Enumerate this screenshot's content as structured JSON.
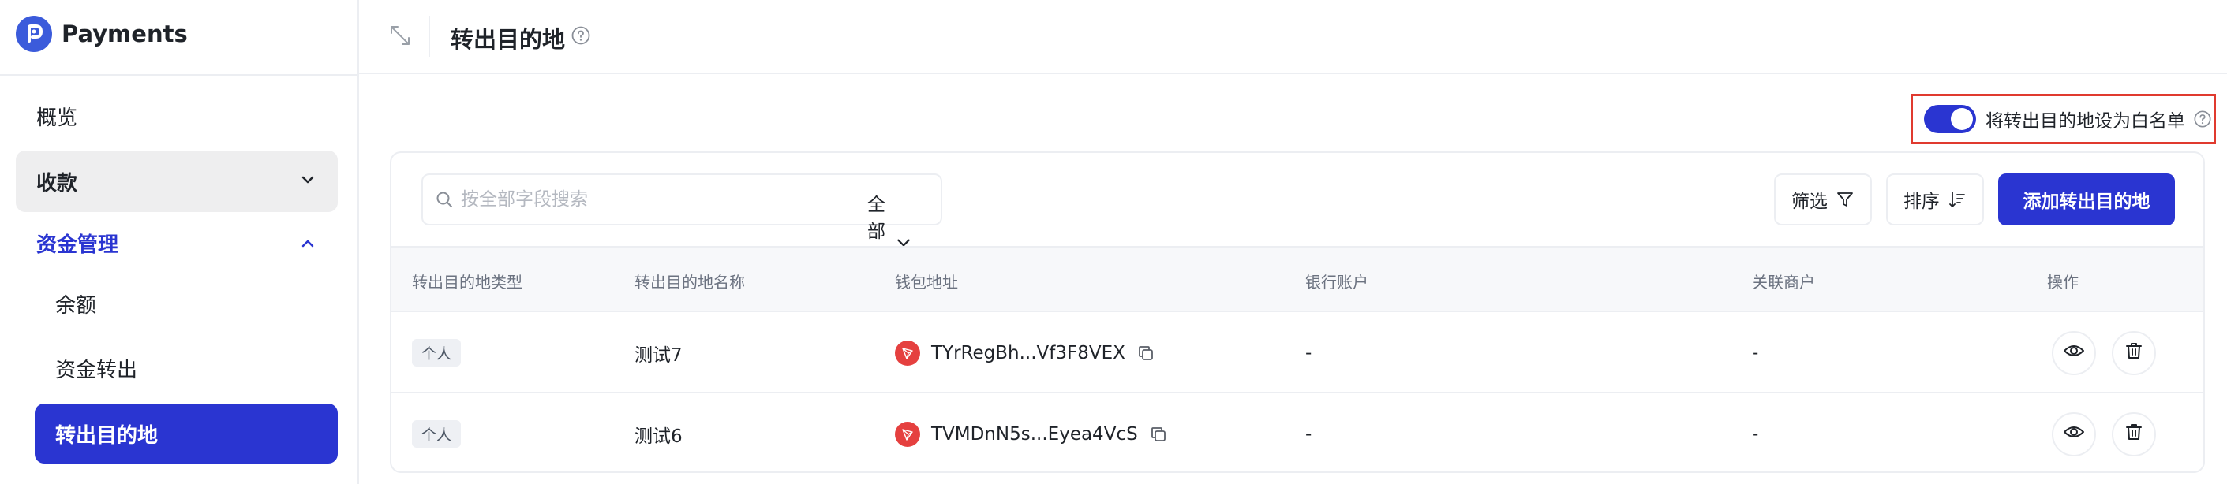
{
  "app": {
    "name": "Payments"
  },
  "sidebar": {
    "items": [
      {
        "label": "概览"
      },
      {
        "label": "收款"
      },
      {
        "label": "资金管理"
      },
      {
        "label": "余额"
      },
      {
        "label": "资金转出"
      },
      {
        "label": "转出目的地"
      }
    ]
  },
  "header": {
    "title": "转出目的地"
  },
  "whitelist": {
    "label": "将转出目的地设为白名单",
    "enabled": true
  },
  "search": {
    "placeholder": "按全部字段搜索",
    "field": "全部字段"
  },
  "toolbar": {
    "filter_label": "筛选",
    "sort_label": "排序",
    "add_label": "添加转出目的地"
  },
  "table": {
    "columns": [
      "转出目的地类型",
      "转出目的地名称",
      "钱包地址",
      "银行账户",
      "关联商户",
      "操作"
    ],
    "rows": [
      {
        "type": "个人",
        "name": "测试7",
        "wallet": "TYrRegBh...Vf3F8VEX",
        "bank": "-",
        "merchant": "-"
      },
      {
        "type": "个人",
        "name": "测试6",
        "wallet": "TVMDnN5s...Eyea4VcS",
        "bank": "-",
        "merchant": "-"
      }
    ]
  },
  "colors": {
    "primary": "#2a35d1",
    "highlight_border": "#e03a2f",
    "tron": "#e5403f"
  },
  "icons": [
    "collapse-icon",
    "help-icon",
    "search-icon",
    "chevron-down-icon",
    "chevron-up-icon",
    "filter-icon",
    "sort-icon",
    "tron-icon",
    "copy-icon",
    "eye-icon",
    "trash-icon"
  ]
}
